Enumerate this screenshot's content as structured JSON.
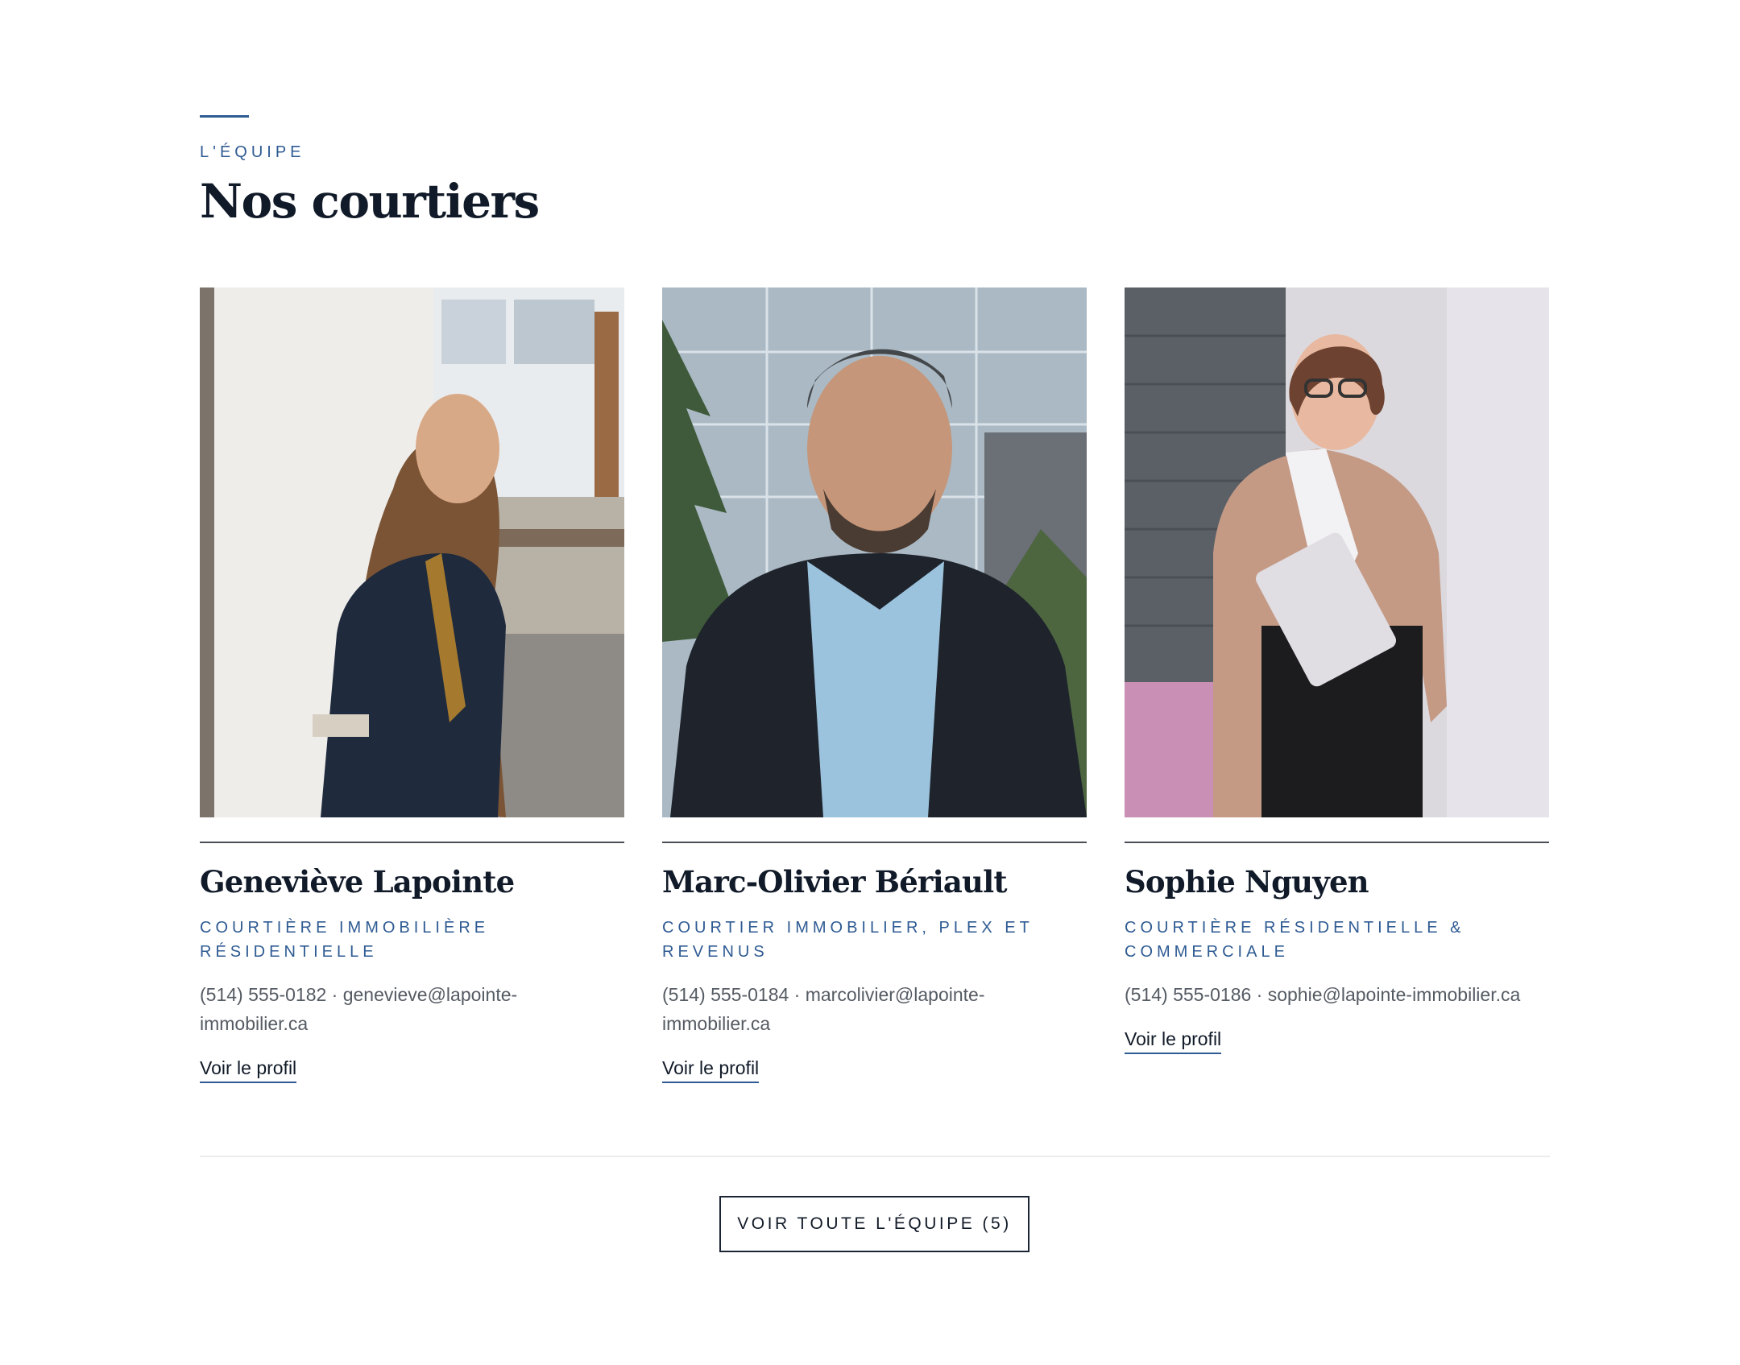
{
  "section": {
    "eyebrow": "L'équipe",
    "title": "Nos courtiers"
  },
  "brokers": [
    {
      "name": "Geneviève Lapointe",
      "role": "Courtière immobilière résidentielle",
      "contact": "(514) 555-0182 · genevieve@lapointe-immobilier.ca",
      "link": "Voir le profil"
    },
    {
      "name": "Marc-Olivier Bériault",
      "role": "Courtier immobilier, plex et revenus",
      "contact": "(514) 555-0184 · marcolivier@lapointe-immobilier.ca",
      "link": "Voir le profil"
    },
    {
      "name": "Sophie Nguyen",
      "role": "Courtière résidentielle & commerciale",
      "contact": "(514) 555-0186 · sophie@lapointe-immobilier.ca",
      "link": "Voir le profil"
    }
  ],
  "cta": {
    "label": "Voir toute l'équipe (5)"
  },
  "colors": {
    "accent": "#2f5b93",
    "heading": "#111a28",
    "body": "#555b63"
  }
}
